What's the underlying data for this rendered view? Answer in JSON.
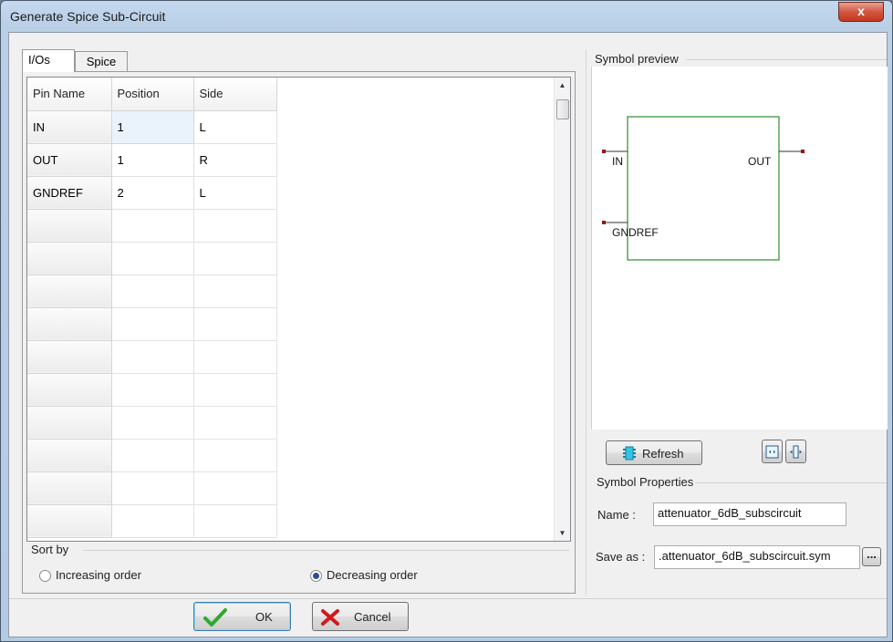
{
  "window": {
    "title": "Generate Spice Sub-Circuit",
    "close_label": "x"
  },
  "tabs": [
    {
      "label": "I/Os"
    },
    {
      "label": "Spice"
    }
  ],
  "grid": {
    "columns": [
      "Pin Name",
      "Position",
      "Side"
    ],
    "rows": [
      [
        "IN",
        "1",
        "L"
      ],
      [
        "OUT",
        "1",
        "R"
      ],
      [
        "GNDREF",
        "2",
        "L"
      ]
    ]
  },
  "sort": {
    "label": "Sort by",
    "options": [
      "Increasing order",
      "Decreasing order"
    ],
    "selected": "Decreasing order"
  },
  "preview": {
    "label": "Symbol preview",
    "pins": {
      "in": "IN",
      "out": "OUT",
      "gndref": "GNDREF"
    },
    "box_color": "#2e8b2e",
    "pin_color": "#8b1a1a"
  },
  "toolbar": {
    "refresh_label": "Refresh",
    "refresh_icon": "refresh-icon",
    "fit_width_icon": "fit-width-icon",
    "fit_height_icon": "fit-height-icon"
  },
  "properties": {
    "label": "Symbol Properties",
    "name_label": "Name :",
    "name_value": "attenuator_6dB_subscircuit",
    "save_label": "Save as :",
    "save_value": ".attenuator_6dB_subscircuit.sym",
    "browse_label": "..."
  },
  "footer": {
    "ok_label": "OK",
    "cancel_label": "Cancel",
    "ok_color": "#2eaa2e",
    "cancel_color": "#d21a1a"
  }
}
